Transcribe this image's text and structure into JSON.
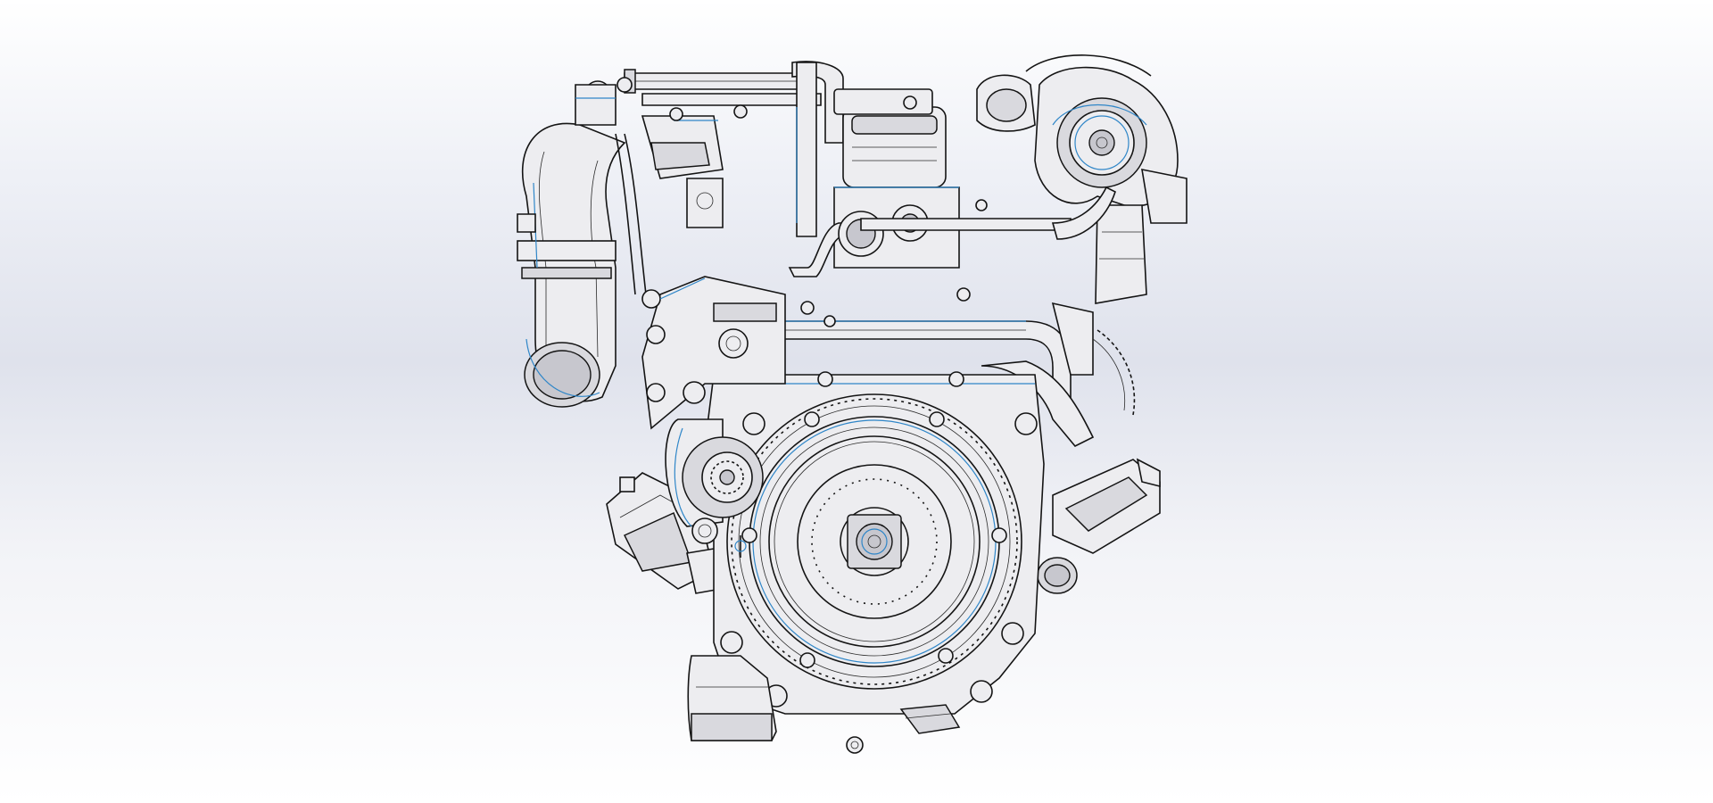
{
  "viewport": {
    "background_top": "#ffffff",
    "background_mid": "#dfe2ec",
    "line_color": "#141414",
    "highlight_edge_color": "#2f86c8",
    "part_fill": "#ededf0"
  },
  "model": {
    "view": "rear",
    "components": [
      {
        "name": "flywheel",
        "icon": "flywheel-icon"
      },
      {
        "name": "clutch-pressure-plate",
        "icon": "clutch-icon"
      },
      {
        "name": "ring-gear",
        "icon": "gear-icon"
      },
      {
        "name": "turbocharger",
        "icon": "turbo-icon"
      },
      {
        "name": "intake-elbow-pipe",
        "icon": "pipe-icon"
      },
      {
        "name": "starter-motor",
        "icon": "starter-icon"
      },
      {
        "name": "engine-mount-left",
        "icon": "bracket-icon"
      },
      {
        "name": "engine-mount-right",
        "icon": "bracket-icon"
      },
      {
        "name": "oil-filter",
        "icon": "filter-icon"
      }
    ]
  }
}
